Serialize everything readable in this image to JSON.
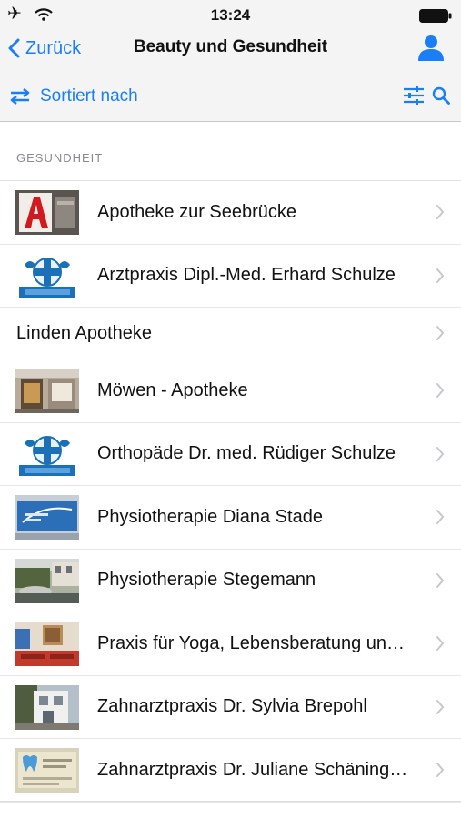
{
  "status_bar": {
    "time": "13:24"
  },
  "nav": {
    "back_label": "Zurück",
    "title": "Beauty und Gesundheit"
  },
  "toolbar": {
    "sort_label": "Sortiert nach"
  },
  "section": {
    "header": "GESUNDHEIT"
  },
  "items": [
    {
      "label": "Apotheke zur Seebrücke",
      "thumb": "pharmacy-logo"
    },
    {
      "label": "Arztpraxis Dipl.-Med. Erhard Schulze",
      "thumb": "doctor-logo"
    },
    {
      "label": "Linden Apotheke",
      "thumb": "none"
    },
    {
      "label": "Möwen - Apotheke",
      "thumb": "shop-photo"
    },
    {
      "label": "Orthopäde Dr. med. Rüdiger Schulze",
      "thumb": "doctor-logo"
    },
    {
      "label": "Physiotherapie Diana Stade",
      "thumb": "blue-sign"
    },
    {
      "label": "Physiotherapie Stegemann",
      "thumb": "street-photo"
    },
    {
      "label": "Praxis für Yoga, Lebensberatung un…",
      "thumb": "room-photo"
    },
    {
      "label": "Zahnarztpraxis Dr. Sylvia Brepohl",
      "thumb": "building-photo"
    },
    {
      "label": "Zahnarztpraxis Dr. Juliane Schäning…",
      "thumb": "dental-sign"
    }
  ],
  "colors": {
    "accent": "#1a7ff5",
    "header_bg": "#f4f4f5",
    "section_text": "#8a8a8f"
  }
}
